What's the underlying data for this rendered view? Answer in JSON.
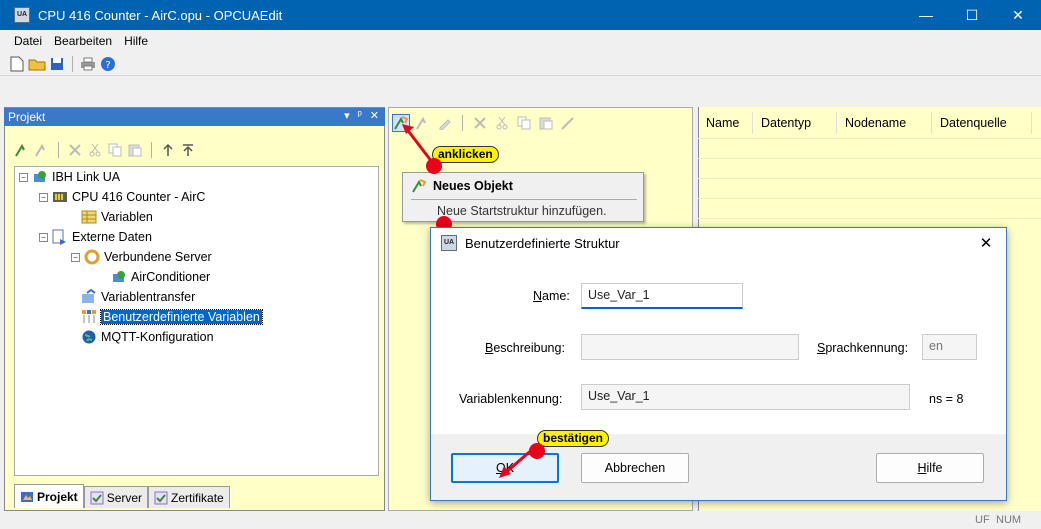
{
  "window": {
    "title": "CPU 416 Counter - AirC.opu - OPCUAEdit",
    "app_icon_text": "UA",
    "minimize": "—",
    "maximize": "☐",
    "close": "✕"
  },
  "menu": [
    "Datei",
    "Bearbeiten",
    "Hilfe"
  ],
  "toolbar_icons": [
    "new-file",
    "open-folder",
    "save",
    "print",
    "help"
  ],
  "project_panel": {
    "title": "Projekt",
    "header_controls": [
      "▾",
      "ᵖ",
      "✕"
    ],
    "tree": [
      {
        "label": "IBH Link UA",
        "expander": "−"
      },
      {
        "label": "CPU 416 Counter - AirC",
        "expander": "−"
      },
      {
        "label": "Variablen",
        "expander": ""
      },
      {
        "label": "Externe Daten",
        "expander": "−"
      },
      {
        "label": "Verbundene Server",
        "expander": "−"
      },
      {
        "label": "AirConditioner",
        "expander": ""
      },
      {
        "label": "Variablentransfer",
        "expander": ""
      },
      {
        "label": "Benutzerdefinierte Variablen",
        "expander": "",
        "selected": true
      },
      {
        "label": "MQTT-Konfiguration",
        "expander": ""
      }
    ],
    "tabs": [
      "Projekt",
      "Server",
      "Zertifikate"
    ]
  },
  "table": {
    "columns": [
      "Name",
      "Datentyp",
      "Nodename",
      "Datenquelle"
    ]
  },
  "tooltip": {
    "title": "Neues Objekt",
    "description": "Neue Startstruktur hinzufügen."
  },
  "annotations": {
    "click": "anklicken",
    "confirm": "bestätigen"
  },
  "dialog": {
    "title": "Benutzerdefinierte Struktur",
    "close": "✕",
    "name_label_pre": "",
    "name_label_u": "N",
    "name_label_post": "ame:",
    "name_value": "Use_Var_1",
    "desc_label_u": "B",
    "desc_label_post": "eschreibung:",
    "desc_value": "",
    "lang_label_u": "S",
    "lang_label_post": "prachkennung:",
    "lang_value": "en",
    "varid_label": "Variablenkennung:",
    "varid_value": "Use_Var_1",
    "ns_text": "ns = 8",
    "ok_u": "O",
    "ok_post": "K",
    "cancel_label": "Abbrechen",
    "help_u": "H",
    "help_post": "ilfe"
  },
  "status": {
    "left": "UF",
    "right": "NUM"
  },
  "colors": {
    "titlebar": "#0063b1",
    "panel_yellow": "#ffffc8",
    "selection": "#0066cc",
    "badge": "#fff200",
    "marker": "#e8001c"
  }
}
